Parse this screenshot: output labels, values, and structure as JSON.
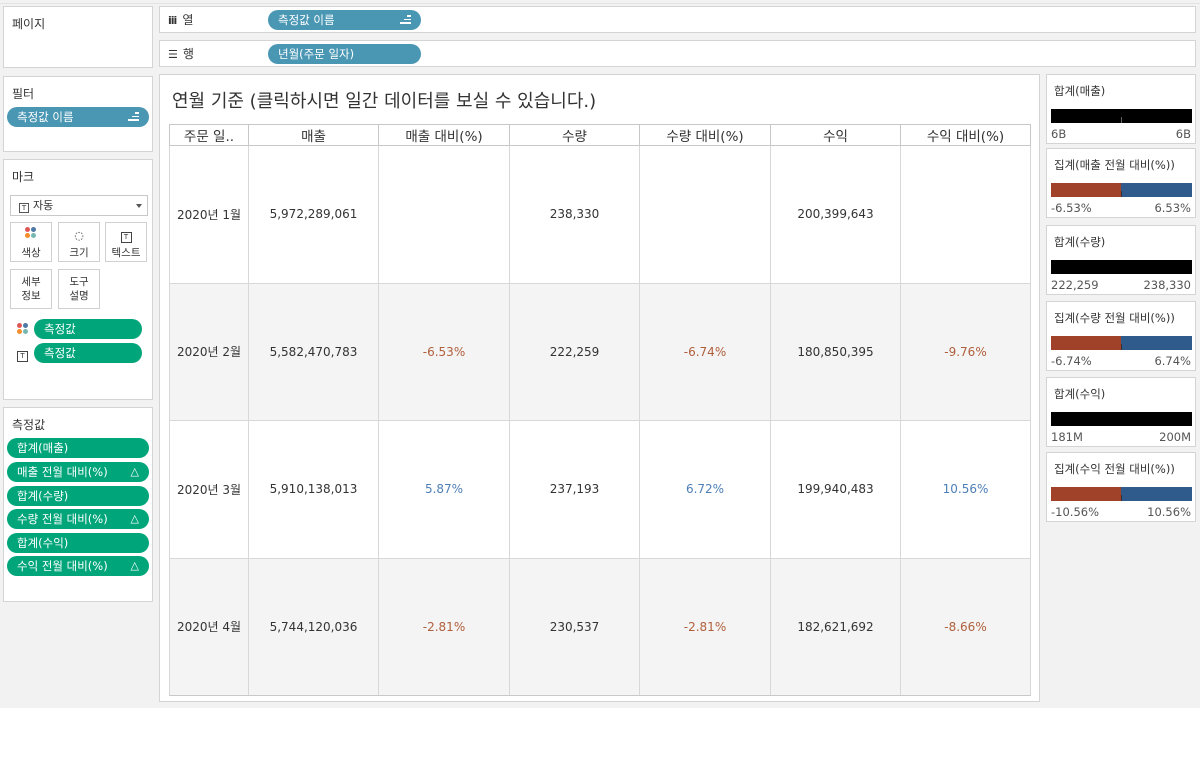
{
  "colors": {
    "accent_blue": "#4a97b4",
    "accent_green": "#00a57a",
    "negative": "#b05f3c",
    "positive": "#4e7fb7",
    "diverge_neg": "#a0412a",
    "diverge_pos": "#2e5b8c"
  },
  "pages": {
    "label": "페이지"
  },
  "columns_shelf": {
    "label": "열",
    "pill": "측정값 이름"
  },
  "rows_shelf": {
    "label": "행",
    "pill": "년월(주문 일자)"
  },
  "filters": {
    "label": "필터",
    "pill": "측정값 이름"
  },
  "marks": {
    "label": "마크",
    "type_value": "자동",
    "buttons": {
      "color": "색상",
      "size": "크기",
      "text": "텍스트",
      "detail": "세부\n정보",
      "tooltip": "도구\n설명"
    },
    "pills": [
      "측정값",
      "측정값"
    ]
  },
  "measure_values": {
    "label": "측정값",
    "items": [
      "합계(매출)",
      "매출 전월 대비(%)",
      "합계(수량)",
      "수량 전월 대비(%)",
      "합계(수익)",
      "수익 전월 대비(%)"
    ]
  },
  "view": {
    "title": "연월 기준 (클릭하시면 일간 데이터를 보실 수 있습니다.)",
    "headers": [
      "주문 일..",
      "매출",
      "매출 대비(%)",
      "수량",
      "수량 대비(%)",
      "수익",
      "수익 대비(%)"
    ],
    "rows": [
      {
        "date": "2020년 1월",
        "sales": "5,972,289,061",
        "sales_pct": "",
        "qty": "238,330",
        "qty_pct": "",
        "profit": "200,399,643",
        "profit_pct": ""
      },
      {
        "date": "2020년 2월",
        "sales": "5,582,470,783",
        "sales_pct": "-6.53%",
        "qty": "222,259",
        "qty_pct": "-6.74%",
        "profit": "180,850,395",
        "profit_pct": "-9.76%"
      },
      {
        "date": "2020년 3월",
        "sales": "5,910,138,013",
        "sales_pct": "5.87%",
        "qty": "237,193",
        "qty_pct": "6.72%",
        "profit": "199,940,483",
        "profit_pct": "10.56%"
      },
      {
        "date": "2020년 4월",
        "sales": "5,744,120,036",
        "sales_pct": "-2.81%",
        "qty": "230,537",
        "qty_pct": "-2.81%",
        "profit": "182,621,692",
        "profit_pct": "-8.66%"
      }
    ]
  },
  "legends": [
    {
      "title": "합계(매출)",
      "min": "6B",
      "max": "6B",
      "kind": "solid"
    },
    {
      "title": "집계(매출 전월 대비(%))",
      "min": "-6.53%",
      "max": "6.53%",
      "kind": "diverging"
    },
    {
      "title": "합계(수량)",
      "min": "222,259",
      "max": "238,330",
      "kind": "solid"
    },
    {
      "title": "집계(수량 전월 대비(%))",
      "min": "-6.74%",
      "max": "6.74%",
      "kind": "diverging"
    },
    {
      "title": "합계(수익)",
      "min": "181M",
      "max": "200M",
      "kind": "solid"
    },
    {
      "title": "집계(수익 전월 대비(%))",
      "min": "-10.56%",
      "max": "10.56%",
      "kind": "diverging"
    }
  ]
}
